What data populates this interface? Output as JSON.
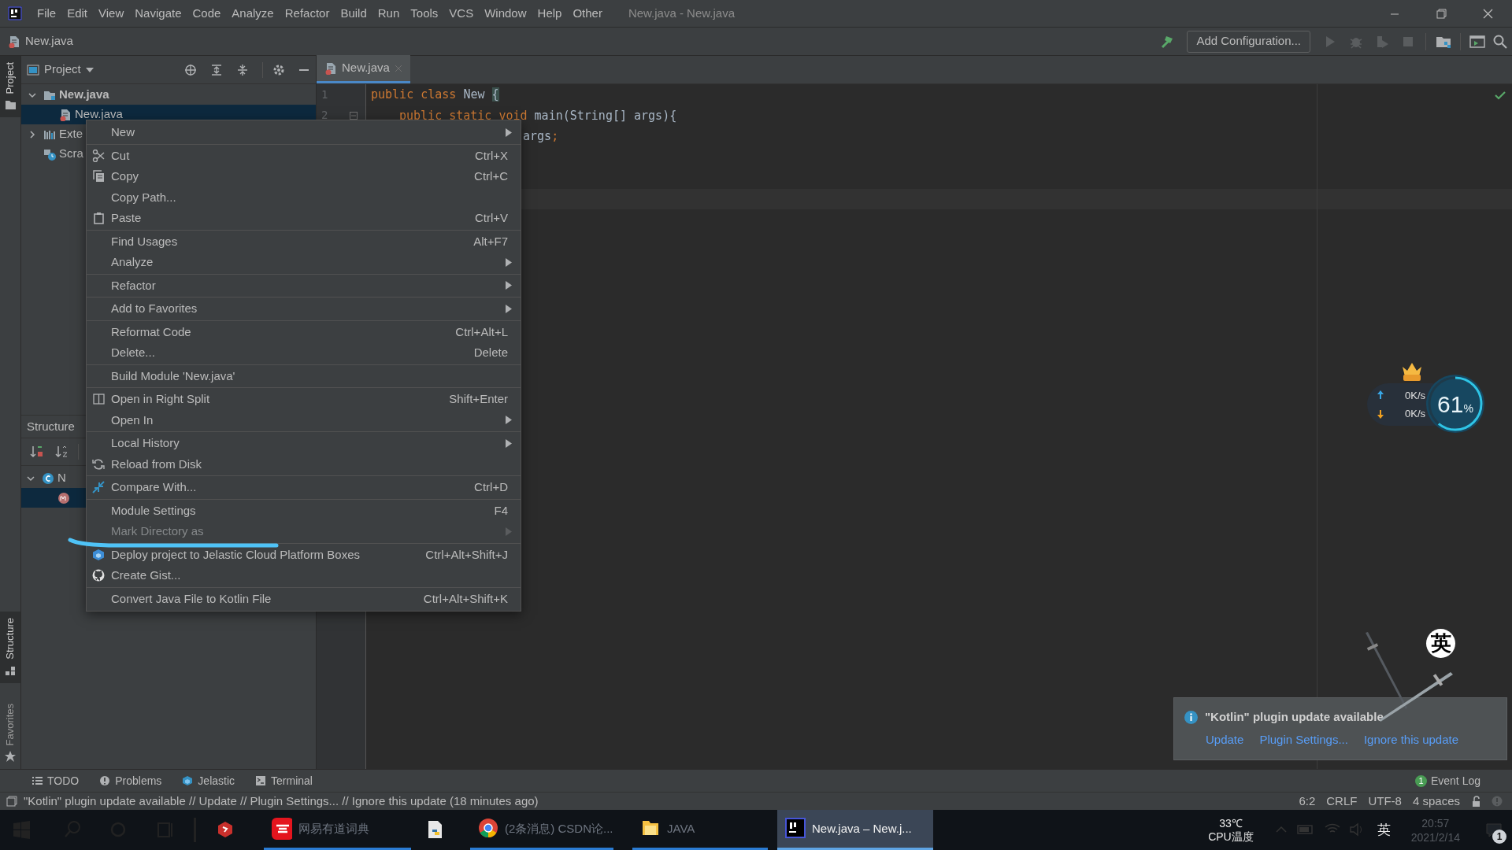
{
  "window": {
    "title": "New.java - New.java",
    "menu": [
      "File",
      "Edit",
      "View",
      "Navigate",
      "Code",
      "Analyze",
      "Refactor",
      "Build",
      "Run",
      "Tools",
      "VCS",
      "Window",
      "Help",
      "Other"
    ]
  },
  "navbar": {
    "breadcrumb": "New.java",
    "run_config": "Add Configuration..."
  },
  "left_stripe": {
    "top": [
      {
        "label": "Project",
        "selected": true
      }
    ],
    "bottom": [
      {
        "label": "Structure",
        "selected": true
      },
      {
        "label": "Favorites",
        "selected": false
      }
    ]
  },
  "project_panel": {
    "title": "Project",
    "tree": [
      {
        "label": "New.java",
        "kind": "module",
        "expanded": true,
        "selected": false,
        "children": [
          {
            "label": "New.java",
            "kind": "file",
            "selected": true
          }
        ]
      },
      {
        "label": "Exte",
        "kind": "libraries",
        "expanded": false,
        "selected": false
      },
      {
        "label": "Scra",
        "kind": "scratches",
        "selected": false
      }
    ]
  },
  "structure_panel": {
    "title": "Structure",
    "tree": [
      {
        "label": "N",
        "kind": "class",
        "expanded": true,
        "selected": false,
        "children": [
          {
            "kind": "method",
            "selected": true
          }
        ]
      }
    ]
  },
  "editor": {
    "tabs": [
      {
        "label": "New.java",
        "selected": true
      }
    ],
    "lines": [
      {
        "number": "1",
        "tokens": [
          {
            "text": "public class",
            "kind": "keyword"
          },
          {
            "text": " New ",
            "kind": "plain"
          },
          {
            "text": "{",
            "kind": "brace"
          }
        ]
      },
      {
        "number": "2",
        "tokens": [
          {
            "text": "public static void",
            "kind": "keyword"
          },
          {
            "text": " main(String[] args){",
            "kind": "plain"
          }
        ]
      },
      {
        "tokens": [
          {
            "text": "args",
            "kind": "plain"
          },
          {
            "text": ";",
            "kind": "keyword"
          }
        ]
      }
    ]
  },
  "context_menu": [
    [
      {
        "label": "New",
        "submenu": true,
        "disabled": false
      }
    ],
    [
      {
        "label": "Cut",
        "shortcut": "Ctrl+X",
        "submenu": false,
        "disabled": false
      },
      {
        "label": "Copy",
        "shortcut": "Ctrl+C",
        "submenu": false,
        "disabled": false
      },
      {
        "label": "Copy Path...",
        "submenu": false,
        "disabled": false
      },
      {
        "label": "Paste",
        "shortcut": "Ctrl+V",
        "submenu": false,
        "disabled": false
      }
    ],
    [
      {
        "label": "Find Usages",
        "shortcut": "Alt+F7",
        "submenu": false,
        "disabled": false
      },
      {
        "label": "Analyze",
        "submenu": true,
        "disabled": false
      }
    ],
    [
      {
        "label": "Refactor",
        "submenu": true,
        "disabled": false
      }
    ],
    [
      {
        "label": "Add to Favorites",
        "submenu": true,
        "disabled": false
      }
    ],
    [
      {
        "label": "Reformat Code",
        "shortcut": "Ctrl+Alt+L",
        "submenu": false,
        "disabled": false
      },
      {
        "label": "Delete...",
        "shortcut": "Delete",
        "submenu": false,
        "disabled": false
      }
    ],
    [
      {
        "label": "Build Module 'New.java'",
        "submenu": false,
        "disabled": false
      }
    ],
    [
      {
        "label": "Open in Right Split",
        "shortcut": "Shift+Enter",
        "submenu": false,
        "disabled": false
      },
      {
        "label": "Open In",
        "submenu": true,
        "disabled": false
      }
    ],
    [
      {
        "label": "Local History",
        "submenu": true,
        "disabled": false
      },
      {
        "label": "Reload from Disk",
        "submenu": false,
        "disabled": false
      }
    ],
    [
      {
        "label": "Compare With...",
        "shortcut": "Ctrl+D",
        "submenu": false,
        "disabled": false
      }
    ],
    [
      {
        "label": "Module Settings",
        "shortcut": "F4",
        "submenu": false,
        "disabled": false
      },
      {
        "label": "Mark Directory as",
        "submenu": true,
        "disabled": true
      }
    ],
    [
      {
        "label": "Deploy project to Jelastic Cloud Platform Boxes",
        "shortcut": "Ctrl+Alt+Shift+J",
        "submenu": false,
        "disabled": false
      },
      {
        "label": "Create Gist...",
        "submenu": false,
        "disabled": false
      }
    ],
    [
      {
        "label": "Convert Java File to Kotlin File",
        "shortcut": "Ctrl+Alt+Shift+K",
        "submenu": false,
        "disabled": false
      }
    ]
  ],
  "net_widget": {
    "upload": "0K/s",
    "download": "0K/s",
    "percent": "61",
    "unit": "%"
  },
  "ime_badge": "英",
  "notification": {
    "title": "\"Kotlin\" plugin update available",
    "actions": [
      "Update",
      "Plugin Settings...",
      "Ignore this update"
    ]
  },
  "tool_bar": {
    "tabs": [
      "TODO",
      "Problems",
      "Jelastic",
      "Terminal"
    ],
    "event_log": {
      "label": "Event Log",
      "count": "1"
    }
  },
  "status_bar": {
    "message": "\"Kotlin\" plugin update available // Update // Plugin Settings... // Ignore this update (18 minutes ago)",
    "items": [
      "6:2",
      "CRLF",
      "UTF-8",
      "4 spaces"
    ]
  },
  "taskbar": {
    "apps": [
      {
        "kind": "app",
        "running": false,
        "selected": false
      },
      {
        "kind": "dictionary",
        "label": "网易有道词典",
        "running": true,
        "selected": false
      },
      {
        "kind": "python",
        "running": false,
        "selected": false
      },
      {
        "kind": "browser",
        "label": "(2条消息) CSDN论...",
        "running": true,
        "selected": false
      },
      {
        "kind": "folder",
        "label": "JAVA",
        "running": true,
        "selected": false
      },
      {
        "kind": "ide",
        "label": "New.java – New.j...",
        "running": true,
        "selected": true
      }
    ],
    "tray": {
      "temperature": "33℃",
      "temperature_label": "CPU温度",
      "ime": "英",
      "time": "20:57",
      "date": "2021/2/14",
      "notifications": "1"
    }
  }
}
